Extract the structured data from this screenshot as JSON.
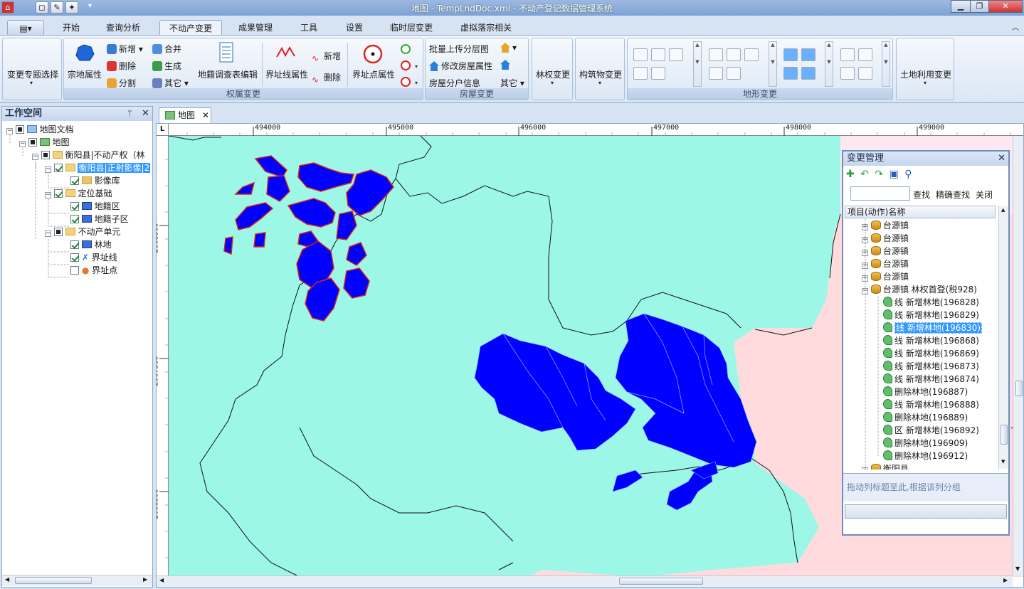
{
  "window": {
    "title": "地图 - TempLndDoc.xml - 不动产登记数据管理系统"
  },
  "tabs": [
    "开始",
    "查询分析",
    "不动产变更",
    "成果管理",
    "工具",
    "设置",
    "临时层变更",
    "虚拟落宗相关"
  ],
  "active_tab": "不动产变更",
  "ribbon": {
    "change_topic": "变更专题选择",
    "zongdi_attr": "宗地属性",
    "add": "新增",
    "delete": "删除",
    "split": "分割",
    "merge": "合并",
    "generate": "生成",
    "other": "其它",
    "survey_edit": "地籍调查表编辑",
    "boundary_line_attr": "界址线属性",
    "line_add": "新增",
    "line_delete": "删除",
    "boundary_point_attr": "界址点属性",
    "group_rights": "权属变更",
    "batch_upload": "批量上传分层图",
    "modify_house": "修改房屋属性",
    "house_info": "房屋分户信息",
    "house_other": "其它",
    "group_house": "房屋变更",
    "forest_change": "林权变更",
    "building_change": "构筑物变更",
    "group_terrain": "地形变更",
    "land_use_change": "土地利用变更"
  },
  "workspace": {
    "title": "工作空间",
    "tree": [
      {
        "label": "地图文档",
        "level": 0
      },
      {
        "label": "地图",
        "level": 1
      },
      {
        "label": "衡阳县|不动产权（林",
        "level": 2
      },
      {
        "label": "衡阳县|正射影像|2",
        "level": 3
      },
      {
        "label": "影像库",
        "level": 4
      },
      {
        "label": "定位基础",
        "level": 3
      },
      {
        "label": "地籍区",
        "level": 4
      },
      {
        "label": "地籍子区",
        "level": 4
      },
      {
        "label": "不动产单元",
        "level": 3
      },
      {
        "label": "林地",
        "level": 4
      },
      {
        "label": "界址线",
        "level": 4
      },
      {
        "label": "界址点",
        "level": 4
      }
    ]
  },
  "map_tab": "地图",
  "ruler": {
    "x_labels": [
      "494000",
      "495000",
      "496000",
      "497000",
      "498000",
      "499000"
    ],
    "y_labels": [
      "2998500",
      "2997500",
      "2996500"
    ]
  },
  "change_panel": {
    "title": "变更管理",
    "search_btn": "查找",
    "exact_btn": "精确查找",
    "close_btn": "关闭",
    "column_header": "项目(动作)名称",
    "groups": [
      "台源镇",
      "台源镇",
      "台源镇",
      "台源镇",
      "台源镇",
      "台源镇 林权首登(税928)"
    ],
    "items": [
      "线 新增林地(196828)",
      "线 新增林地(196829)",
      "线 新增林地(196830)",
      "线 新增林地(196868)",
      "线 新增林地(196869)",
      "线 新增林地(196873)",
      "线 新增林地(196874)",
      "删除林地(196887)",
      "线 新增林地(196888)",
      "删除林地(196889)",
      "区 新增林地(196892)",
      "删除林地(196909)",
      "删除林地(196912)"
    ],
    "last_group": "衡阳县",
    "group_hint": "拖动列标题至此,根据该列分组",
    "selected_index": 2
  },
  "colors": {
    "land": "#9cf7e6",
    "forest": "#0000ff",
    "pink": "#ffdbdd",
    "accent": "#3399ff"
  }
}
